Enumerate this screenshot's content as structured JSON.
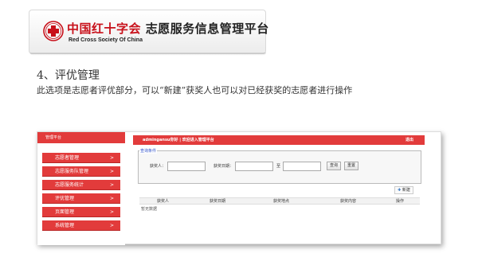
{
  "banner": {
    "title_cn": "中国红十字会",
    "title_rest": "志愿服务信息管理平台",
    "subtitle": "Red Cross Society Of China",
    "logo_color": "#c8101a"
  },
  "section": {
    "title": "4、评优管理",
    "description": "此选项是志愿者评优部分，可以“新建”获奖人也可以对已经获奖的志愿者进行操作"
  },
  "app": {
    "sidebar": {
      "header": "管理平台",
      "items": [
        {
          "label": "志愿者管理",
          "arrow": ">"
        },
        {
          "label": "志愿服务队管理",
          "arrow": ">"
        },
        {
          "label": "志愿服务统计",
          "arrow": ">"
        },
        {
          "label": "评优管理",
          "arrow": ">"
        },
        {
          "label": "页面管理",
          "arrow": ">"
        },
        {
          "label": "系统管理",
          "arrow": ">"
        }
      ]
    },
    "topbar": {
      "user_text": "admingansu你好  |  欢迎进入管理平台",
      "logout": "退出"
    },
    "search": {
      "legend": "查询条件",
      "winner_label": "获奖人：",
      "date_label": "获奖日期：",
      "to_label": "至",
      "query_button": "查询",
      "reset_button": "重置"
    },
    "new_button": "新建",
    "table": {
      "columns": [
        "获奖人",
        "获奖日期",
        "获奖地点",
        "获奖内容",
        "操作"
      ],
      "empty_text": "暂无数据"
    },
    "accent_color": "#e23b3b"
  }
}
